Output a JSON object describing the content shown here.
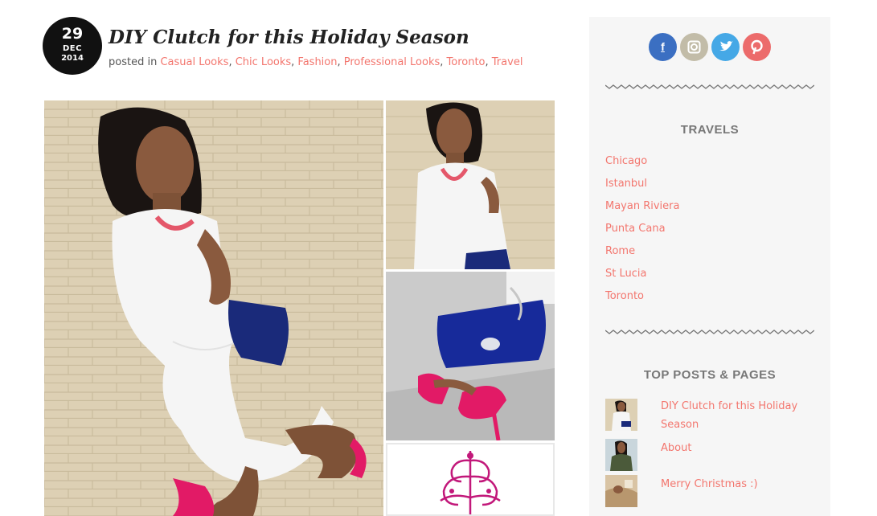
{
  "post": {
    "date": {
      "day": "29",
      "month": "DEC",
      "year": "2014"
    },
    "title": "DIY Clutch for this Holiday Season",
    "posted_in_label": "posted in",
    "categories": [
      "Casual Looks",
      "Chic Looks",
      "Fashion",
      "Professional Looks",
      "Toronto",
      "Travel"
    ]
  },
  "sidebar": {
    "social": [
      {
        "name": "facebook",
        "glyph": "f",
        "color": "#3b6fc2"
      },
      {
        "name": "instagram",
        "glyph": "◘",
        "color": "#c2bca8"
      },
      {
        "name": "twitter",
        "glyph": "t",
        "color": "#45a8e6"
      },
      {
        "name": "pinterest",
        "glyph": "℗",
        "color": "#ec6b6b"
      }
    ],
    "travels": {
      "title": "TRAVELS",
      "items": [
        "Chicago",
        "Istanbul",
        "Mayan Riviera",
        "Punta Cana",
        "Rome",
        "St Lucia",
        "Toronto"
      ]
    },
    "top_posts": {
      "title": "TOP POSTS & PAGES",
      "items": [
        "DIY Clutch for this Holiday Season",
        "About",
        "Merry Christmas :)"
      ]
    }
  },
  "colors": {
    "link": "#f3766e",
    "badge": "#111111",
    "sidebar_bg": "#f6f6f6"
  }
}
